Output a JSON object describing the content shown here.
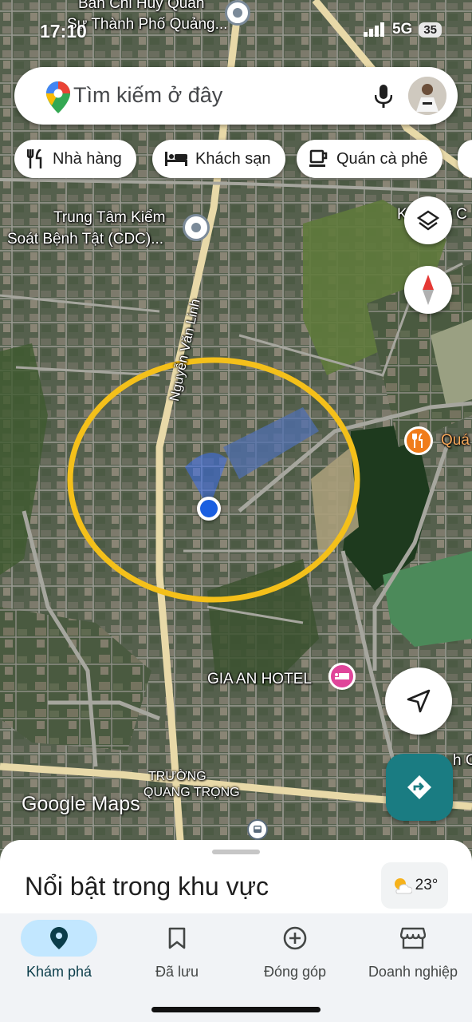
{
  "status_bar": {
    "time": "17:10",
    "signal": "5G",
    "battery": "35"
  },
  "search": {
    "placeholder": "Tìm kiếm ở đây"
  },
  "chips": [
    {
      "label": "Nhà hàng",
      "icon": "restaurant-icon"
    },
    {
      "label": "Khách sạn",
      "icon": "hotel-icon"
    },
    {
      "label": "Quán cà phê",
      "icon": "coffee-icon"
    }
  ],
  "map": {
    "labels": {
      "top_place": "Ban Chỉ Huy Quân",
      "top_place2": "Sự Thành Phố Quảng...",
      "cdc_line1": "Trung Tâm Kiểm",
      "cdc_line2": "Soát Bệnh Tật (CDC)...",
      "road": "Nguyễn Văn Linh",
      "right_top": "K",
      "right_top2": "ai C",
      "restaurant_right": "Quá",
      "hotel": "GIA AN HOTEL",
      "right_bottom": "h C",
      "school_line1": "TRƯỜNG",
      "school_line2": "QUANG TRỌNG",
      "attribution": "Google Maps"
    },
    "annotation_color": "#f4c01a",
    "location_color": "#1a5fe0"
  },
  "sheet": {
    "title": "Nổi bật trong khu vực",
    "temperature": "23°"
  },
  "nav": [
    {
      "label": "Khám phá",
      "icon": "explore-pin-icon",
      "active": true
    },
    {
      "label": "Đã lưu",
      "icon": "bookmark-icon",
      "active": false
    },
    {
      "label": "Đóng góp",
      "icon": "add-circle-icon",
      "active": false
    },
    {
      "label": "Doanh nghiệp",
      "icon": "storefront-icon",
      "active": false
    }
  ]
}
